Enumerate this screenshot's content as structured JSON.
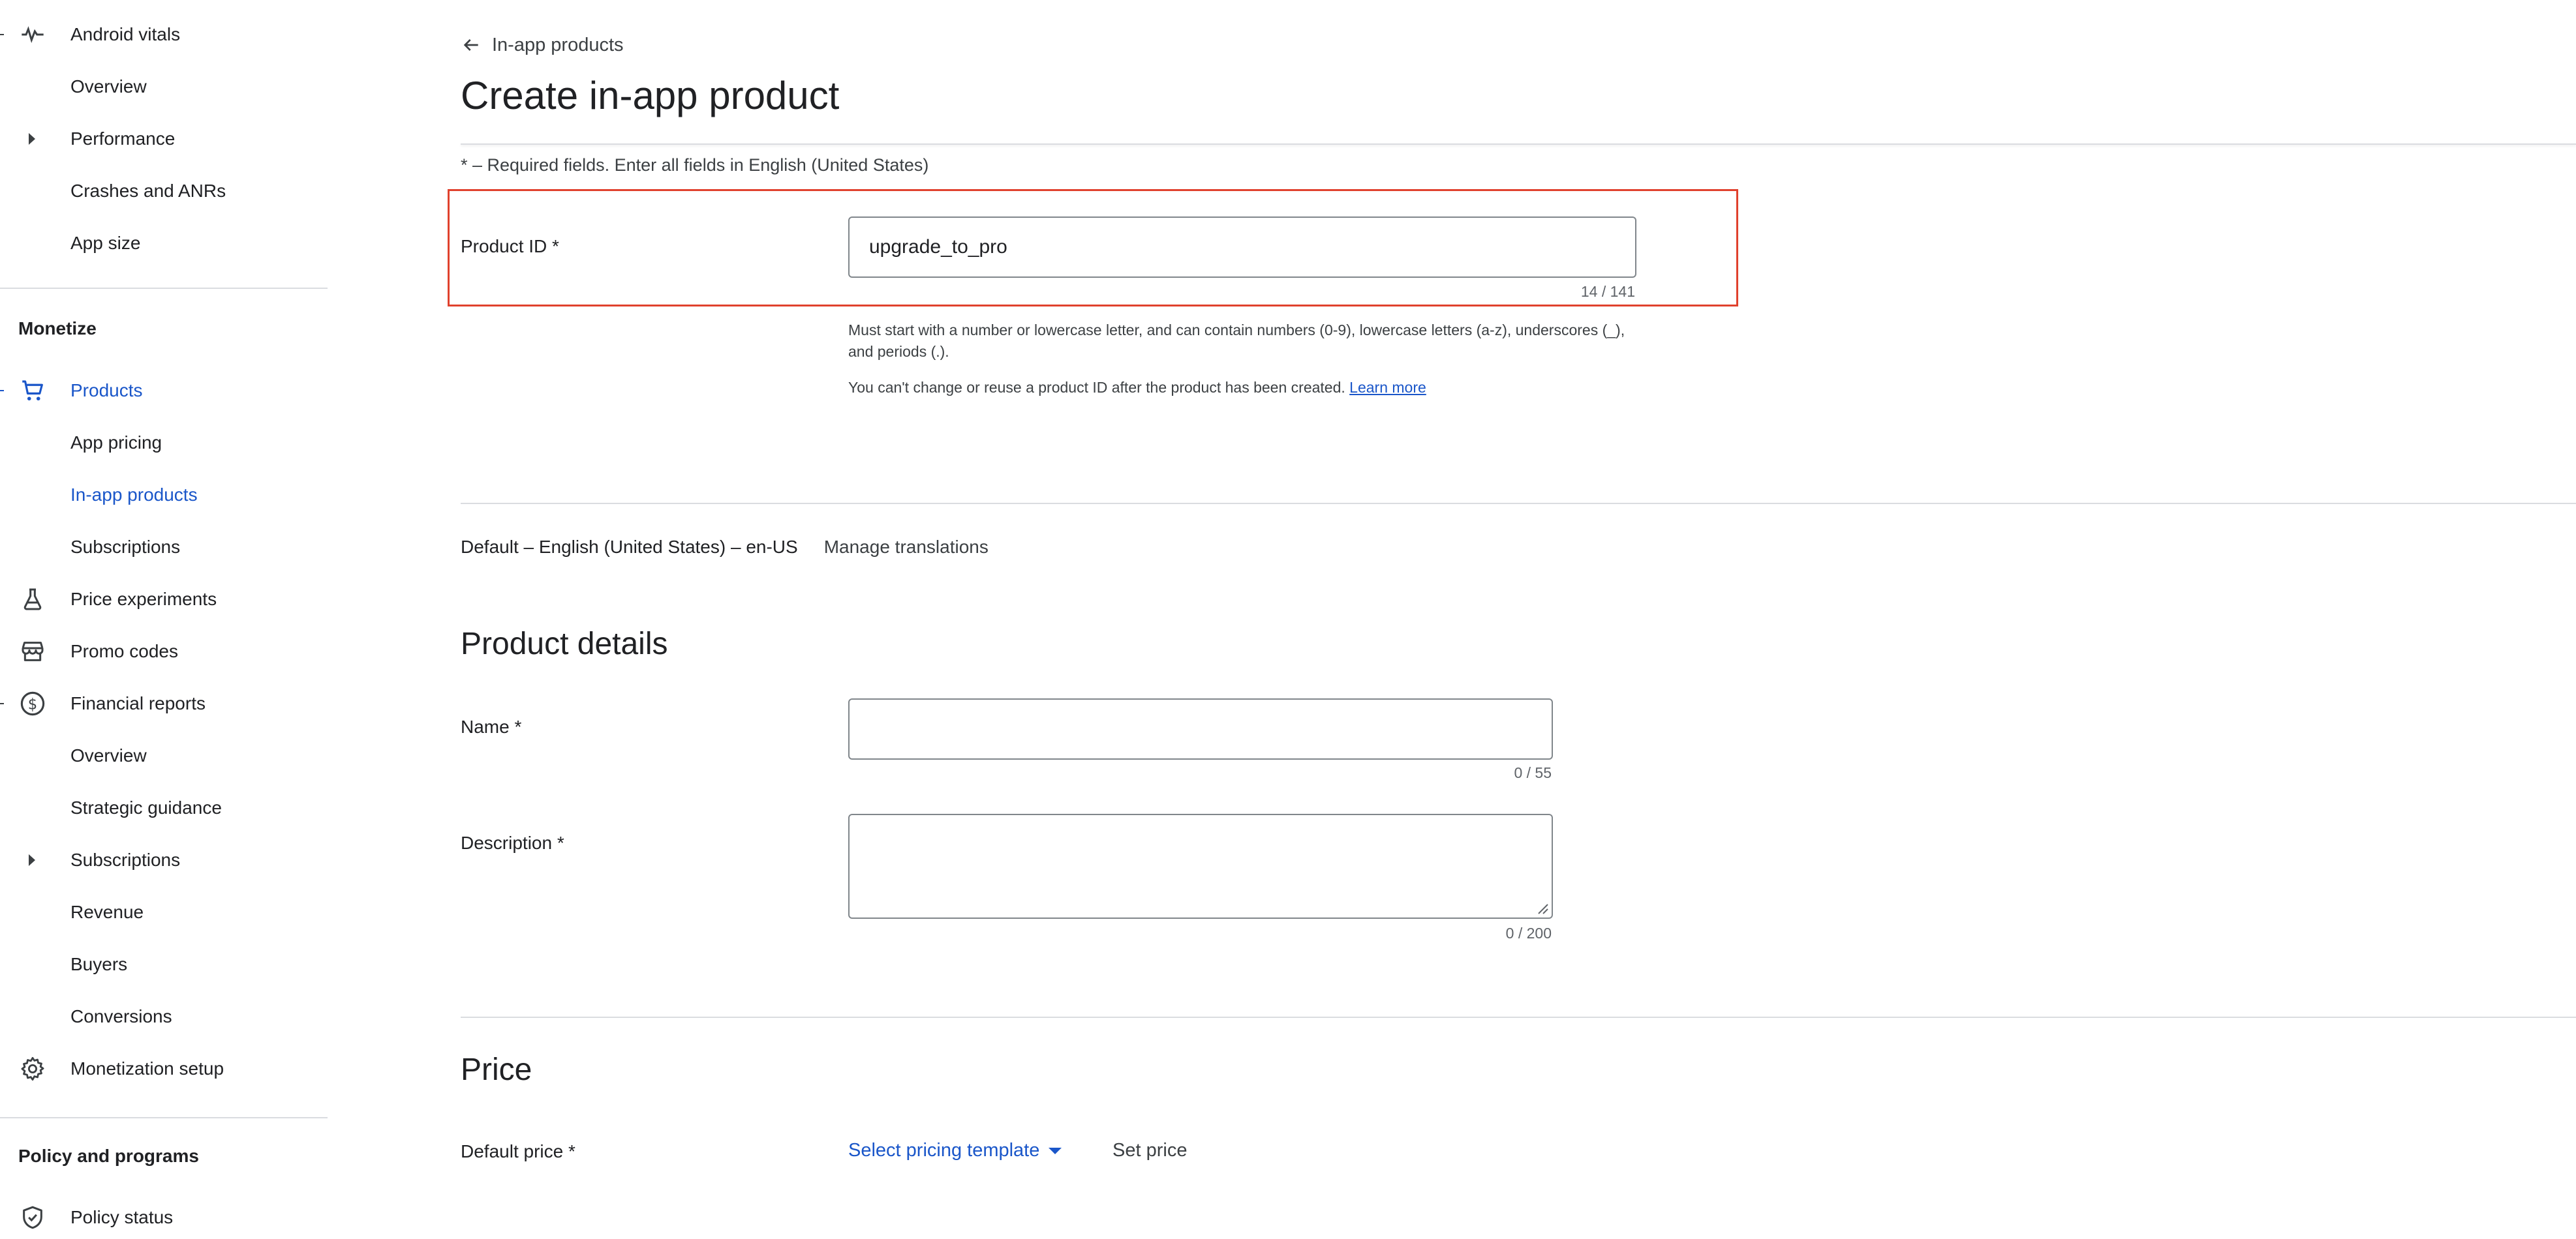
{
  "sidebar": {
    "items": [
      {
        "label": "Android vitals"
      },
      {
        "label": "Overview"
      },
      {
        "label": "Performance"
      },
      {
        "label": "Crashes and ANRs"
      },
      {
        "label": "App size"
      },
      {
        "label": "Products"
      },
      {
        "label": "App pricing"
      },
      {
        "label": "In-app products"
      },
      {
        "label": "Subscriptions"
      },
      {
        "label": "Price experiments"
      },
      {
        "label": "Promo codes"
      },
      {
        "label": "Financial reports"
      },
      {
        "label": "Overview"
      },
      {
        "label": "Strategic guidance"
      },
      {
        "label": "Subscriptions"
      },
      {
        "label": "Revenue"
      },
      {
        "label": "Buyers"
      },
      {
        "label": "Conversions"
      },
      {
        "label": "Monetization setup"
      },
      {
        "label": "Policy status"
      }
    ],
    "sections": {
      "monetize": "Monetize",
      "policy": "Policy and programs"
    },
    "active_color": "#1a56c9"
  },
  "header": {
    "back_label": "In-app products",
    "title": "Create in-app product"
  },
  "form": {
    "required_note": "* – Required fields. Enter all fields in English (United States)",
    "product_id": {
      "label": "Product ID  *",
      "value": "upgrade_to_pro",
      "counter": "14 / 141",
      "help1": "Must start with a number or lowercase letter, and can contain numbers (0-9), lowercase letters (a-z), underscores (_), and periods (.).",
      "help2": "You can't change or reuse a product ID after the product has been created.",
      "learn_more": "Learn more"
    },
    "language": {
      "default": "Default – English (United States) – en-US",
      "manage": "Manage translations"
    },
    "details": {
      "title": "Product details",
      "name_label": "Name  *",
      "name_value": "",
      "name_counter": "0 / 55",
      "desc_label": "Description  *",
      "desc_value": "",
      "desc_counter": "0 / 200"
    },
    "price": {
      "title": "Price",
      "default_label": "Default price  *",
      "select_template": "Select pricing template",
      "set_price": "Set price"
    }
  },
  "highlight_color": "#e0412d"
}
